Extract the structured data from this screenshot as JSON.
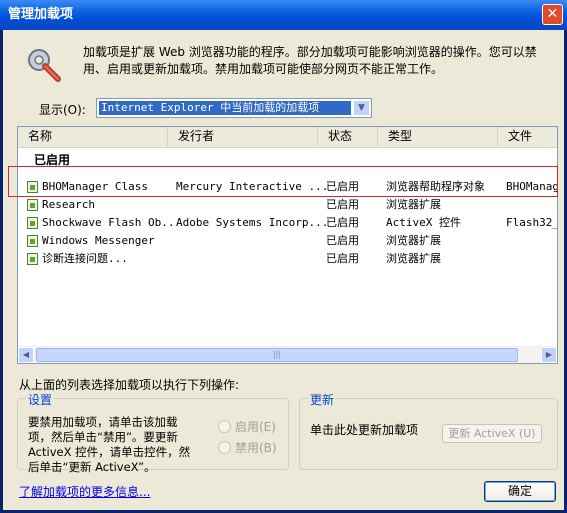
{
  "window": {
    "title": "管理加载项",
    "close_symbol": "✕"
  },
  "intro": {
    "text": "加载项是扩展 Web 浏览器功能的程序。部分加载项可能影响浏览器的操作。您可以禁用、启用或更新加载项。禁用加载项可能使部分网页不能正常工作。"
  },
  "show": {
    "label": "显示(O):",
    "value": "Internet Explorer 中当前加载的加载项"
  },
  "columns": [
    "名称",
    "发行者",
    "状态",
    "类型",
    "文件"
  ],
  "group_label": "已启用",
  "rows": [
    {
      "name": "BHOManager Class",
      "publisher": "Mercury Interactive ...",
      "status": "已启用",
      "type": "浏览器帮助程序对象",
      "file": "BHOManag"
    },
    {
      "name": "Research",
      "publisher": "",
      "status": "已启用",
      "type": "浏览器扩展",
      "file": ""
    },
    {
      "name": "Shockwave Flash Ob...",
      "publisher": "Adobe Systems Incorp...",
      "status": "已启用",
      "type": "ActiveX 控件",
      "file": "Flash32_"
    },
    {
      "name": "Windows Messenger",
      "publisher": "",
      "status": "已启用",
      "type": "浏览器扩展",
      "file": ""
    },
    {
      "name": "诊断连接问题...",
      "publisher": "",
      "status": "已启用",
      "type": "浏览器扩展",
      "file": ""
    }
  ],
  "instruction": "从上面的列表选择加载项以执行下列操作:",
  "settings": {
    "title": "设置",
    "text": "要禁用加载项，请单击该加载项，然后单击“禁用”。要更新 ActiveX 控件，请单击控件，然后单击“更新 ActiveX”。",
    "enable_label": "启用(E)",
    "disable_label": "禁用(B)"
  },
  "update": {
    "title": "更新",
    "text": "单击此处更新加载项",
    "button_label": "更新 ActiveX (U)"
  },
  "footer": {
    "link": "了解加载项的更多信息...",
    "ok_label": "确定"
  }
}
